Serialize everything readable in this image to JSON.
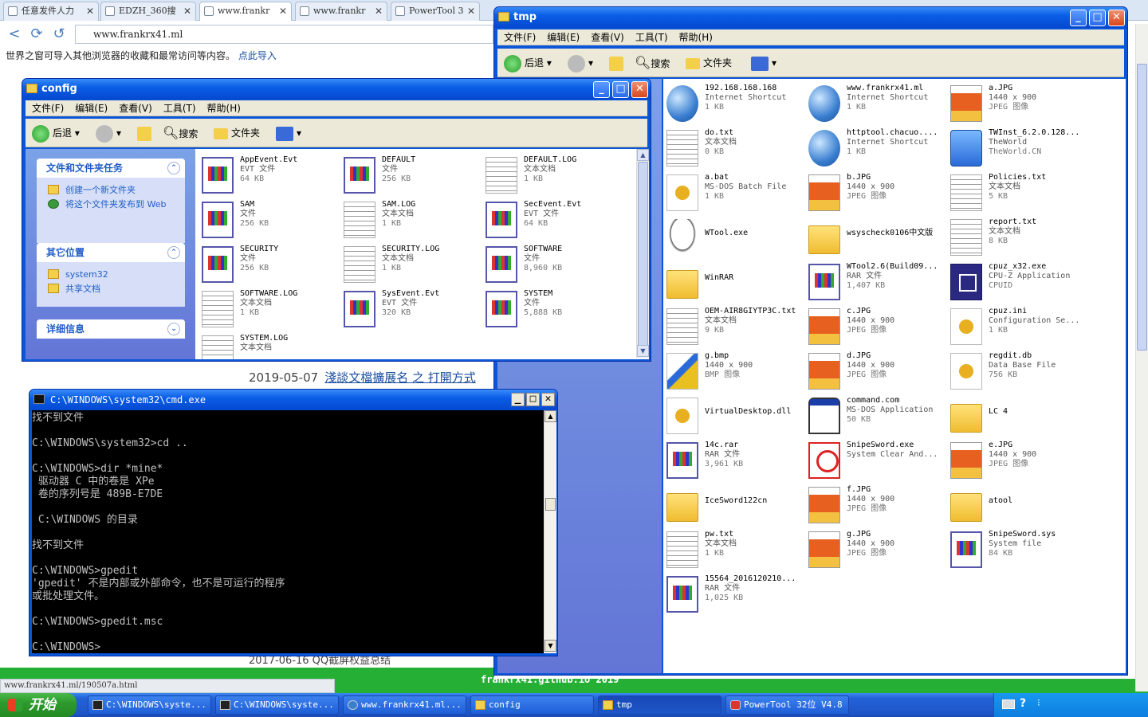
{
  "browser": {
    "tabs": [
      {
        "label": "任意发件人力"
      },
      {
        "label": "EDZH_360搜"
      },
      {
        "label": "www.frankr"
      },
      {
        "label": "www.frankr"
      },
      {
        "label": "PowerTool 3"
      }
    ],
    "address": "www.frankrx41.ml",
    "infobar_text": "世界之窗可导入其他浏览器的收藏和最常访问等内容。",
    "infobar_link": "点此导入",
    "post_date": "2019-05-07",
    "post_link": "淺談文檔擴展名 之 打開方式",
    "bottom_post": "2017-06-16  QQ截屏权益总结",
    "status_url": "www.frankrx41.ml/190507a.html",
    "footer": "frankrx41.github.io 2019"
  },
  "config_window": {
    "title": "config",
    "menu": [
      "文件(F)",
      "编辑(E)",
      "查看(V)",
      "工具(T)",
      "帮助(H)"
    ],
    "toolbar": {
      "back": "后退",
      "search": "搜索",
      "folders": "文件夹"
    },
    "tasks_panel": {
      "title": "文件和文件夹任务",
      "items": [
        "创建一个新文件夹",
        "将这个文件夹发布到 Web"
      ]
    },
    "places_panel": {
      "title": "其它位置",
      "items": [
        "system32",
        "共享文档"
      ]
    },
    "details_panel": {
      "title": "详细信息"
    },
    "files": [
      {
        "name": "AppEvent.Evt",
        "type": "EVT 文件",
        "size": "64 KB",
        "icon": "exe"
      },
      {
        "name": "DEFAULT",
        "type": "文件",
        "size": "256 KB",
        "icon": "exe"
      },
      {
        "name": "DEFAULT.LOG",
        "type": "文本文档",
        "size": "1 KB",
        "icon": "doc"
      },
      {
        "name": "SAM",
        "type": "文件",
        "size": "256 KB",
        "icon": "exe"
      },
      {
        "name": "SAM.LOG",
        "type": "文本文档",
        "size": "1 KB",
        "icon": "doc"
      },
      {
        "name": "SecEvent.Evt",
        "type": "EVT 文件",
        "size": "64 KB",
        "icon": "exe"
      },
      {
        "name": "SECURITY",
        "type": "文件",
        "size": "256 KB",
        "icon": "exe"
      },
      {
        "name": "SECURITY.LOG",
        "type": "文本文档",
        "size": "1 KB",
        "icon": "doc"
      },
      {
        "name": "SOFTWARE",
        "type": "文件",
        "size": "8,960 KB",
        "icon": "exe"
      },
      {
        "name": "SOFTWARE.LOG",
        "type": "文本文档",
        "size": "1 KB",
        "icon": "doc"
      },
      {
        "name": "SysEvent.Evt",
        "type": "EVT 文件",
        "size": "320 KB",
        "icon": "exe"
      },
      {
        "name": "SYSTEM",
        "type": "文件",
        "size": "5,888 KB",
        "icon": "exe"
      },
      {
        "name": "SYSTEM.LOG",
        "type": "文本文档",
        "size": "",
        "icon": "doc"
      }
    ]
  },
  "tmp_window": {
    "title": "tmp",
    "menu": [
      "文件(F)",
      "编辑(E)",
      "查看(V)",
      "工具(T)",
      "帮助(H)"
    ],
    "toolbar": {
      "back": "后退",
      "search": "搜索",
      "folders": "文件夹"
    },
    "files": [
      {
        "name": "192.168.168.168",
        "type": "Internet Shortcut",
        "size": "1 KB",
        "icon": "globe"
      },
      {
        "name": "www.frankrx41.ml",
        "type": "Internet Shortcut",
        "size": "1 KB",
        "icon": "globe"
      },
      {
        "name": "a.JPG",
        "type": "1440 x 900",
        "size": "JPEG 图像",
        "icon": "jpg"
      },
      {
        "name": "do.txt",
        "type": "文本文档",
        "size": "0 KB",
        "icon": "doc"
      },
      {
        "name": "httptool.chacuo....",
        "type": "Internet Shortcut",
        "size": "1 KB",
        "icon": "globe"
      },
      {
        "name": "TWInst_6.2.0.128...",
        "type": "TheWorld",
        "size": "TheWorld.CN",
        "icon": "tw"
      },
      {
        "name": "a.bat",
        "type": "MS-DOS Batch File",
        "size": "1 KB",
        "icon": "gear"
      },
      {
        "name": "b.JPG",
        "type": "1440 x 900",
        "size": "JPEG 图像",
        "icon": "jpg"
      },
      {
        "name": "Policies.txt",
        "type": "文本文档",
        "size": "5 KB",
        "icon": "doc"
      },
      {
        "name": "WTool.exe",
        "type": "",
        "size": "",
        "icon": "ghost"
      },
      {
        "name": "wsyscheck0106中文版",
        "type": "",
        "size": "",
        "icon": "folder"
      },
      {
        "name": "report.txt",
        "type": "文本文档",
        "size": "8 KB",
        "icon": "doc"
      },
      {
        "name": "WinRAR",
        "type": "",
        "size": "",
        "icon": "folder"
      },
      {
        "name": "WTool2.6(Build09...",
        "type": "RAR 文件",
        "size": "1,407 KB",
        "icon": "exe"
      },
      {
        "name": "cpuz_x32.exe",
        "type": "CPU-Z Application",
        "size": "CPUID",
        "icon": "cpu"
      },
      {
        "name": "OEM-AIR8GIYTP3C.txt",
        "type": "文本文档",
        "size": "9 KB",
        "icon": "doc"
      },
      {
        "name": "c.JPG",
        "type": "1440 x 900",
        "size": "JPEG 图像",
        "icon": "jpg"
      },
      {
        "name": "cpuz.ini",
        "type": "Configuration Se...",
        "size": "1 KB",
        "icon": "gear"
      },
      {
        "name": "g.bmp",
        "type": "1440 x 900",
        "size": "BMP 图像",
        "icon": "brush"
      },
      {
        "name": "d.JPG",
        "type": "1440 x 900",
        "size": "JPEG 图像",
        "icon": "jpg"
      },
      {
        "name": "regdit.db",
        "type": "Data Base File",
        "size": "756 KB",
        "icon": "gear"
      },
      {
        "name": "VirtualDesktop.dll",
        "type": "",
        "size": "",
        "icon": "gear"
      },
      {
        "name": "command.com",
        "type": "MS-DOS Application",
        "size": "50 KB",
        "icon": "win"
      },
      {
        "name": "LC 4",
        "type": "",
        "size": "",
        "icon": "folder"
      },
      {
        "name": "14c.rar",
        "type": "RAR 文件",
        "size": "3,961 KB",
        "icon": "exe"
      },
      {
        "name": "SnipeSword.exe",
        "type": "System Clear And...",
        "size": "",
        "icon": "sword"
      },
      {
        "name": "e.JPG",
        "type": "1440 x 900",
        "size": "JPEG 图像",
        "icon": "jpg"
      },
      {
        "name": "IceSword122cn",
        "type": "",
        "size": "",
        "icon": "folder"
      },
      {
        "name": "f.JPG",
        "type": "1440 x 900",
        "size": "JPEG 图像",
        "icon": "jpg"
      },
      {
        "name": "atool",
        "type": "",
        "size": "",
        "icon": "folder"
      },
      {
        "name": "pw.txt",
        "type": "文本文档",
        "size": "1 KB",
        "icon": "doc"
      },
      {
        "name": "g.JPG",
        "type": "1440 x 900",
        "size": "JPEG 图像",
        "icon": "jpg"
      },
      {
        "name": "SnipeSword.sys",
        "type": "System file",
        "size": "84 KB",
        "icon": "exe"
      },
      {
        "name": "15564_2016120210...",
        "type": "RAR 文件",
        "size": "1,025 KB",
        "icon": "exe"
      }
    ]
  },
  "cmd_window": {
    "title": "C:\\WINDOWS\\system32\\cmd.exe",
    "lines": [
      "找不到文件",
      "",
      "C:\\WINDOWS\\system32>cd ..",
      "",
      "C:\\WINDOWS>dir *mine*",
      " 驱动器 C 中的卷是 XPe",
      " 卷的序列号是 489B-E7DE",
      "",
      " C:\\WINDOWS 的目录",
      "",
      "找不到文件",
      "",
      "C:\\WINDOWS>gpedit",
      "'gpedit' 不是内部或外部命令，也不是可运行的程序",
      "或批处理文件。",
      "",
      "C:\\WINDOWS>gpedit.msc",
      "",
      "C:\\WINDOWS>"
    ]
  },
  "taskbar": {
    "start": "开始",
    "items": [
      "C:\\WINDOWS\\syste...",
      "C:\\WINDOWS\\syste...",
      "www.frankrx41.ml...",
      "config",
      "tmp",
      "PowerTool 32位 V4.8"
    ]
  }
}
